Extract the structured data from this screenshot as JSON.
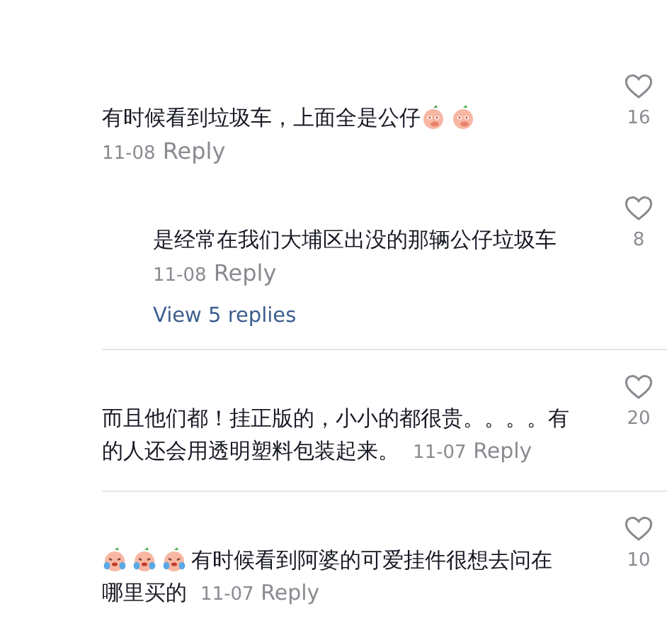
{
  "comments": [
    {
      "segments": [
        {
          "kind": "text",
          "text": "有时候看到垃圾车，上面全是公仔"
        },
        {
          "kind": "smirk-peach"
        },
        {
          "kind": "smirk-peach"
        }
      ],
      "meta_inline": false,
      "date": "11-08",
      "reply": "Reply",
      "likes": "16",
      "replies": [
        {
          "segments": [
            {
              "kind": "text",
              "text": "是经常在我们大埔区出没的那辆公仔垃圾车"
            }
          ],
          "meta_inline": false,
          "date": "11-08",
          "reply": "Reply",
          "likes": "8"
        }
      ],
      "view_replies": "View 5 replies"
    },
    {
      "segments": [
        {
          "kind": "text",
          "text": "而且他们都！挂正版的，小小的都很贵。。。。有的人还会用透明塑料包装起来。"
        }
      ],
      "meta_inline": true,
      "date": "11-07",
      "reply": "Reply",
      "likes": "20"
    },
    {
      "segments": [
        {
          "kind": "crying-peach"
        },
        {
          "kind": "crying-peach"
        },
        {
          "kind": "crying-peach"
        },
        {
          "kind": "text",
          "text": "有时候看到阿婆的可爱挂件很想去问在哪里买的"
        }
      ],
      "meta_inline": true,
      "date": "11-07",
      "reply": "Reply",
      "likes": "10"
    }
  ]
}
